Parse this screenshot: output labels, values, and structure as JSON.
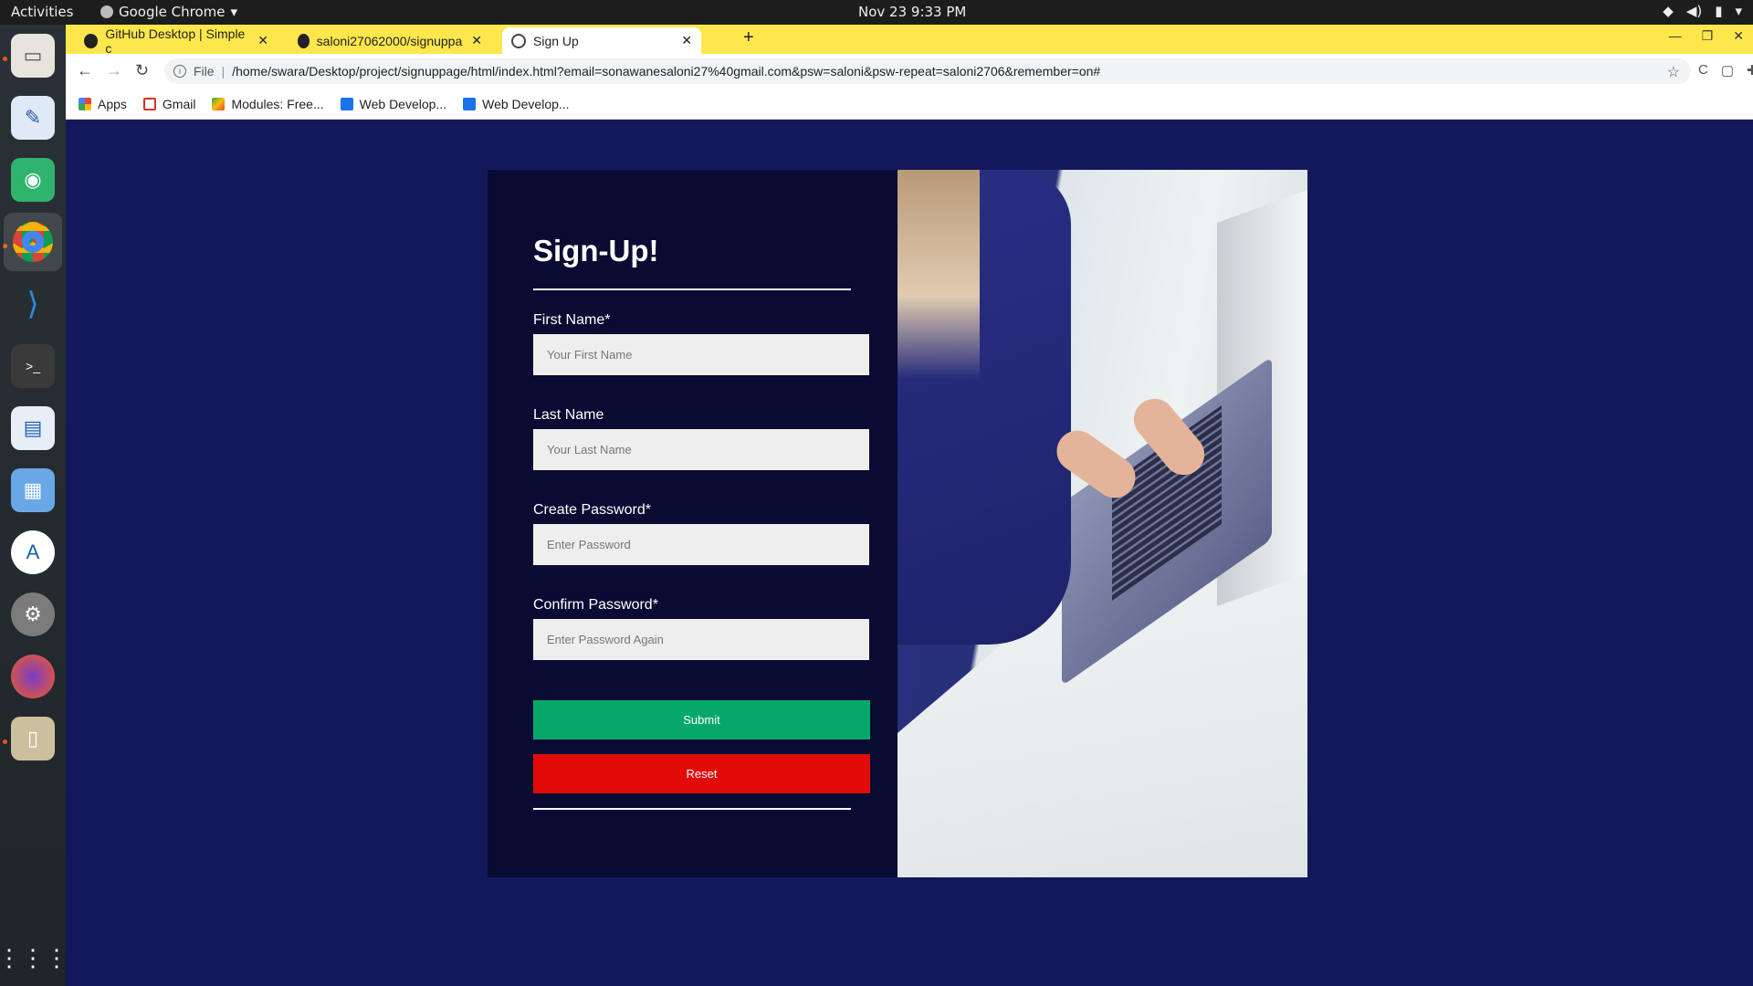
{
  "system": {
    "activities": "Activities",
    "app_menu": "Google Chrome",
    "clock": "Nov 23  9:33 PM"
  },
  "browser": {
    "tabs": [
      {
        "label": "GitHub Desktop | Simple c",
        "active": false
      },
      {
        "label": "saloni27062000/signuppa",
        "active": false
      },
      {
        "label": "Sign Up",
        "active": true
      }
    ],
    "omnibox": {
      "scheme": "File",
      "url": "/home/swara/Desktop/project/signuppage/html/index.html?email=sonawanesaloni27%40gmail.com&psw=saloni&psw-repeat=saloni2706&remember=on#"
    },
    "bookmarks": [
      {
        "label": "Apps",
        "icon": "apps-grid-icon"
      },
      {
        "label": "Gmail",
        "icon": "gmail-icon"
      },
      {
        "label": "Modules: Free...",
        "icon": "modules-icon"
      },
      {
        "label": "Web Develop...",
        "icon": "is-icon"
      },
      {
        "label": "Web Develop...",
        "icon": "is-icon"
      }
    ]
  },
  "form": {
    "title": "Sign-Up!",
    "fields": [
      {
        "label": "First Name*",
        "placeholder": "Your First Name"
      },
      {
        "label": "Last Name",
        "placeholder": "Your Last Name"
      },
      {
        "label": "Create Password*",
        "placeholder": "Enter Password"
      },
      {
        "label": "Confirm Password*",
        "placeholder": "Enter Password Again"
      }
    ],
    "submit_label": "Submit",
    "reset_label": "Reset"
  },
  "colors": {
    "page_bg": "#13185c",
    "form_bg": "#090b33",
    "submit": "#06a86a",
    "reset": "#e30a0a",
    "tabstrip": "#fde74c"
  }
}
